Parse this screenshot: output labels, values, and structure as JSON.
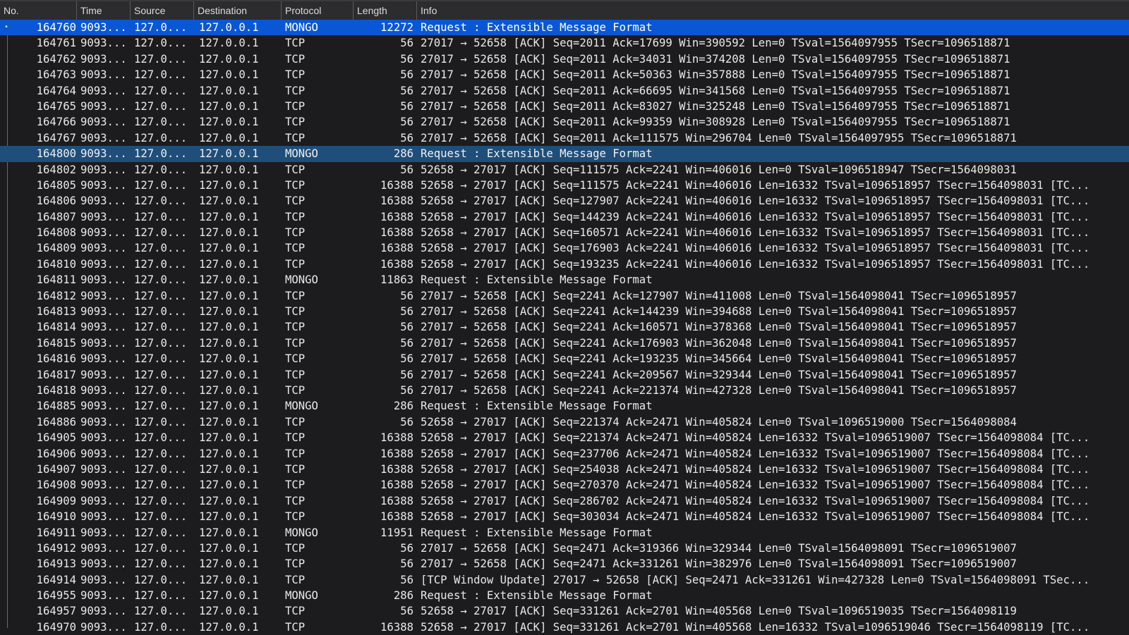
{
  "columns": {
    "no": "No.",
    "time": "Time",
    "source": "Source",
    "destination": "Destination",
    "protocol": "Protocol",
    "length": "Length",
    "info": "Info"
  },
  "colors": {
    "background": "#1c1c1e",
    "selected_row": "#0a57d6",
    "related_row": "#1f4e7a"
  },
  "packets": [
    {
      "no": "164760",
      "time": "9093...",
      "src": "127.0...",
      "dst": "127.0.0.1",
      "proto": "MONGO",
      "len": "12272",
      "info": "Request : Extensible Message Format",
      "state": "selected"
    },
    {
      "no": "164761",
      "time": "9093...",
      "src": "127.0...",
      "dst": "127.0.0.1",
      "proto": "TCP",
      "len": "56",
      "info": "27017 → 52658 [ACK] Seq=2011 Ack=17699 Win=390592 Len=0 TSval=1564097955 TSecr=1096518871"
    },
    {
      "no": "164762",
      "time": "9093...",
      "src": "127.0...",
      "dst": "127.0.0.1",
      "proto": "TCP",
      "len": "56",
      "info": "27017 → 52658 [ACK] Seq=2011 Ack=34031 Win=374208 Len=0 TSval=1564097955 TSecr=1096518871"
    },
    {
      "no": "164763",
      "time": "9093...",
      "src": "127.0...",
      "dst": "127.0.0.1",
      "proto": "TCP",
      "len": "56",
      "info": "27017 → 52658 [ACK] Seq=2011 Ack=50363 Win=357888 Len=0 TSval=1564097955 TSecr=1096518871"
    },
    {
      "no": "164764",
      "time": "9093...",
      "src": "127.0...",
      "dst": "127.0.0.1",
      "proto": "TCP",
      "len": "56",
      "info": "27017 → 52658 [ACK] Seq=2011 Ack=66695 Win=341568 Len=0 TSval=1564097955 TSecr=1096518871"
    },
    {
      "no": "164765",
      "time": "9093...",
      "src": "127.0...",
      "dst": "127.0.0.1",
      "proto": "TCP",
      "len": "56",
      "info": "27017 → 52658 [ACK] Seq=2011 Ack=83027 Win=325248 Len=0 TSval=1564097955 TSecr=1096518871"
    },
    {
      "no": "164766",
      "time": "9093...",
      "src": "127.0...",
      "dst": "127.0.0.1",
      "proto": "TCP",
      "len": "56",
      "info": "27017 → 52658 [ACK] Seq=2011 Ack=99359 Win=308928 Len=0 TSval=1564097955 TSecr=1096518871"
    },
    {
      "no": "164767",
      "time": "9093...",
      "src": "127.0...",
      "dst": "127.0.0.1",
      "proto": "TCP",
      "len": "56",
      "info": "27017 → 52658 [ACK] Seq=2011 Ack=111575 Win=296704 Len=0 TSval=1564097955 TSecr=1096518871"
    },
    {
      "no": "164800",
      "time": "9093...",
      "src": "127.0...",
      "dst": "127.0.0.1",
      "proto": "MONGO",
      "len": "286",
      "info": "Request : Extensible Message Format",
      "state": "related"
    },
    {
      "no": "164802",
      "time": "9093...",
      "src": "127.0...",
      "dst": "127.0.0.1",
      "proto": "TCP",
      "len": "56",
      "info": "52658 → 27017 [ACK] Seq=111575 Ack=2241 Win=406016 Len=0 TSval=1096518947 TSecr=1564098031"
    },
    {
      "no": "164805",
      "time": "9093...",
      "src": "127.0...",
      "dst": "127.0.0.1",
      "proto": "TCP",
      "len": "16388",
      "info": "52658 → 27017 [ACK] Seq=111575 Ack=2241 Win=406016 Len=16332 TSval=1096518957 TSecr=1564098031 [TC..."
    },
    {
      "no": "164806",
      "time": "9093...",
      "src": "127.0...",
      "dst": "127.0.0.1",
      "proto": "TCP",
      "len": "16388",
      "info": "52658 → 27017 [ACK] Seq=127907 Ack=2241 Win=406016 Len=16332 TSval=1096518957 TSecr=1564098031 [TC..."
    },
    {
      "no": "164807",
      "time": "9093...",
      "src": "127.0...",
      "dst": "127.0.0.1",
      "proto": "TCP",
      "len": "16388",
      "info": "52658 → 27017 [ACK] Seq=144239 Ack=2241 Win=406016 Len=16332 TSval=1096518957 TSecr=1564098031 [TC..."
    },
    {
      "no": "164808",
      "time": "9093...",
      "src": "127.0...",
      "dst": "127.0.0.1",
      "proto": "TCP",
      "len": "16388",
      "info": "52658 → 27017 [ACK] Seq=160571 Ack=2241 Win=406016 Len=16332 TSval=1096518957 TSecr=1564098031 [TC..."
    },
    {
      "no": "164809",
      "time": "9093...",
      "src": "127.0...",
      "dst": "127.0.0.1",
      "proto": "TCP",
      "len": "16388",
      "info": "52658 → 27017 [ACK] Seq=176903 Ack=2241 Win=406016 Len=16332 TSval=1096518957 TSecr=1564098031 [TC..."
    },
    {
      "no": "164810",
      "time": "9093...",
      "src": "127.0...",
      "dst": "127.0.0.1",
      "proto": "TCP",
      "len": "16388",
      "info": "52658 → 27017 [ACK] Seq=193235 Ack=2241 Win=406016 Len=16332 TSval=1096518957 TSecr=1564098031 [TC..."
    },
    {
      "no": "164811",
      "time": "9093...",
      "src": "127.0...",
      "dst": "127.0.0.1",
      "proto": "MONGO",
      "len": "11863",
      "info": "Request : Extensible Message Format"
    },
    {
      "no": "164812",
      "time": "9093...",
      "src": "127.0...",
      "dst": "127.0.0.1",
      "proto": "TCP",
      "len": "56",
      "info": "27017 → 52658 [ACK] Seq=2241 Ack=127907 Win=411008 Len=0 TSval=1564098041 TSecr=1096518957"
    },
    {
      "no": "164813",
      "time": "9093...",
      "src": "127.0...",
      "dst": "127.0.0.1",
      "proto": "TCP",
      "len": "56",
      "info": "27017 → 52658 [ACK] Seq=2241 Ack=144239 Win=394688 Len=0 TSval=1564098041 TSecr=1096518957"
    },
    {
      "no": "164814",
      "time": "9093...",
      "src": "127.0...",
      "dst": "127.0.0.1",
      "proto": "TCP",
      "len": "56",
      "info": "27017 → 52658 [ACK] Seq=2241 Ack=160571 Win=378368 Len=0 TSval=1564098041 TSecr=1096518957"
    },
    {
      "no": "164815",
      "time": "9093...",
      "src": "127.0...",
      "dst": "127.0.0.1",
      "proto": "TCP",
      "len": "56",
      "info": "27017 → 52658 [ACK] Seq=2241 Ack=176903 Win=362048 Len=0 TSval=1564098041 TSecr=1096518957"
    },
    {
      "no": "164816",
      "time": "9093...",
      "src": "127.0...",
      "dst": "127.0.0.1",
      "proto": "TCP",
      "len": "56",
      "info": "27017 → 52658 [ACK] Seq=2241 Ack=193235 Win=345664 Len=0 TSval=1564098041 TSecr=1096518957"
    },
    {
      "no": "164817",
      "time": "9093...",
      "src": "127.0...",
      "dst": "127.0.0.1",
      "proto": "TCP",
      "len": "56",
      "info": "27017 → 52658 [ACK] Seq=2241 Ack=209567 Win=329344 Len=0 TSval=1564098041 TSecr=1096518957"
    },
    {
      "no": "164818",
      "time": "9093...",
      "src": "127.0...",
      "dst": "127.0.0.1",
      "proto": "TCP",
      "len": "56",
      "info": "27017 → 52658 [ACK] Seq=2241 Ack=221374 Win=427328 Len=0 TSval=1564098041 TSecr=1096518957"
    },
    {
      "no": "164885",
      "time": "9093...",
      "src": "127.0...",
      "dst": "127.0.0.1",
      "proto": "MONGO",
      "len": "286",
      "info": "Request : Extensible Message Format"
    },
    {
      "no": "164886",
      "time": "9093...",
      "src": "127.0...",
      "dst": "127.0.0.1",
      "proto": "TCP",
      "len": "56",
      "info": "52658 → 27017 [ACK] Seq=221374 Ack=2471 Win=405824 Len=0 TSval=1096519000 TSecr=1564098084"
    },
    {
      "no": "164905",
      "time": "9093...",
      "src": "127.0...",
      "dst": "127.0.0.1",
      "proto": "TCP",
      "len": "16388",
      "info": "52658 → 27017 [ACK] Seq=221374 Ack=2471 Win=405824 Len=16332 TSval=1096519007 TSecr=1564098084 [TC..."
    },
    {
      "no": "164906",
      "time": "9093...",
      "src": "127.0...",
      "dst": "127.0.0.1",
      "proto": "TCP",
      "len": "16388",
      "info": "52658 → 27017 [ACK] Seq=237706 Ack=2471 Win=405824 Len=16332 TSval=1096519007 TSecr=1564098084 [TC..."
    },
    {
      "no": "164907",
      "time": "9093...",
      "src": "127.0...",
      "dst": "127.0.0.1",
      "proto": "TCP",
      "len": "16388",
      "info": "52658 → 27017 [ACK] Seq=254038 Ack=2471 Win=405824 Len=16332 TSval=1096519007 TSecr=1564098084 [TC..."
    },
    {
      "no": "164908",
      "time": "9093...",
      "src": "127.0...",
      "dst": "127.0.0.1",
      "proto": "TCP",
      "len": "16388",
      "info": "52658 → 27017 [ACK] Seq=270370 Ack=2471 Win=405824 Len=16332 TSval=1096519007 TSecr=1564098084 [TC..."
    },
    {
      "no": "164909",
      "time": "9093...",
      "src": "127.0...",
      "dst": "127.0.0.1",
      "proto": "TCP",
      "len": "16388",
      "info": "52658 → 27017 [ACK] Seq=286702 Ack=2471 Win=405824 Len=16332 TSval=1096519007 TSecr=1564098084 [TC..."
    },
    {
      "no": "164910",
      "time": "9093...",
      "src": "127.0...",
      "dst": "127.0.0.1",
      "proto": "TCP",
      "len": "16388",
      "info": "52658 → 27017 [ACK] Seq=303034 Ack=2471 Win=405824 Len=16332 TSval=1096519007 TSecr=1564098084 [TC..."
    },
    {
      "no": "164911",
      "time": "9093...",
      "src": "127.0...",
      "dst": "127.0.0.1",
      "proto": "MONGO",
      "len": "11951",
      "info": "Request : Extensible Message Format"
    },
    {
      "no": "164912",
      "time": "9093...",
      "src": "127.0...",
      "dst": "127.0.0.1",
      "proto": "TCP",
      "len": "56",
      "info": "27017 → 52658 [ACK] Seq=2471 Ack=319366 Win=329344 Len=0 TSval=1564098091 TSecr=1096519007"
    },
    {
      "no": "164913",
      "time": "9093...",
      "src": "127.0...",
      "dst": "127.0.0.1",
      "proto": "TCP",
      "len": "56",
      "info": "27017 → 52658 [ACK] Seq=2471 Ack=331261 Win=382976 Len=0 TSval=1564098091 TSecr=1096519007"
    },
    {
      "no": "164914",
      "time": "9093...",
      "src": "127.0...",
      "dst": "127.0.0.1",
      "proto": "TCP",
      "len": "56",
      "info": "[TCP Window Update] 27017 → 52658 [ACK] Seq=2471 Ack=331261 Win=427328 Len=0 TSval=1564098091 TSec..."
    },
    {
      "no": "164955",
      "time": "9093...",
      "src": "127.0...",
      "dst": "127.0.0.1",
      "proto": "MONGO",
      "len": "286",
      "info": "Request : Extensible Message Format"
    },
    {
      "no": "164957",
      "time": "9093...",
      "src": "127.0...",
      "dst": "127.0.0.1",
      "proto": "TCP",
      "len": "56",
      "info": "52658 → 27017 [ACK] Seq=331261 Ack=2701 Win=405568 Len=0 TSval=1096519035 TSecr=1564098119"
    },
    {
      "no": "164970",
      "time": "9093...",
      "src": "127.0...",
      "dst": "127.0.0.1",
      "proto": "TCP",
      "len": "16388",
      "info": "52658 → 27017 [ACK] Seq=331261 Ack=2701 Win=405568 Len=16332 TSval=1096519046 TSecr=1564098119 [TC..."
    }
  ]
}
